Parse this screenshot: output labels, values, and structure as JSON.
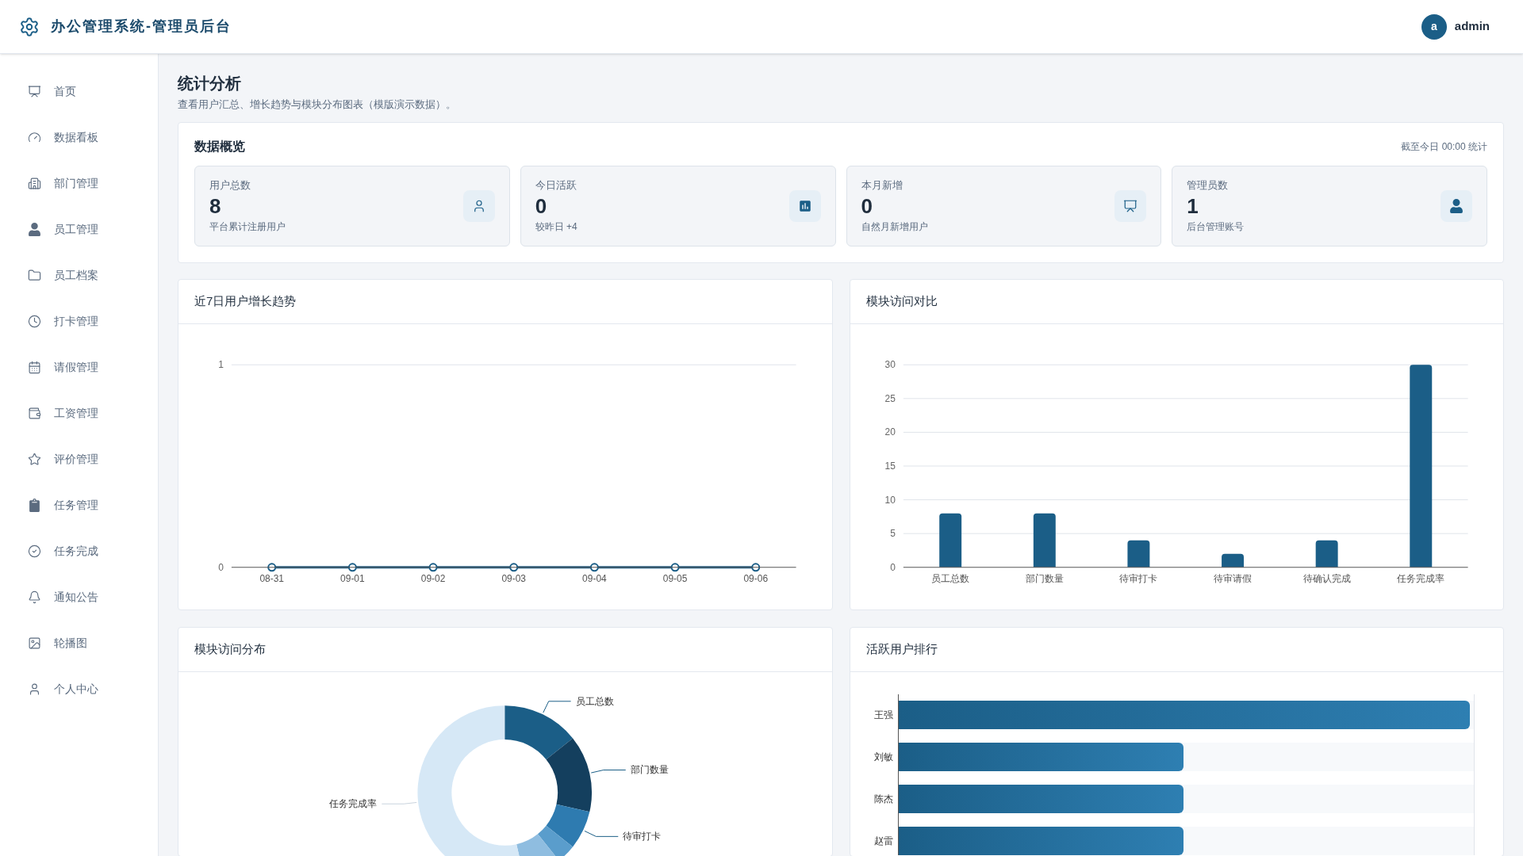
{
  "header": {
    "title": "办公管理系统-管理员后台",
    "user": {
      "avatar": "a",
      "name": "admin"
    }
  },
  "sidebar": {
    "items": [
      {
        "label": "首页"
      },
      {
        "label": "数据看板"
      },
      {
        "label": "部门管理"
      },
      {
        "label": "员工管理"
      },
      {
        "label": "员工档案"
      },
      {
        "label": "打卡管理"
      },
      {
        "label": "请假管理"
      },
      {
        "label": "工资管理"
      },
      {
        "label": "评价管理"
      },
      {
        "label": "任务管理"
      },
      {
        "label": "任务完成"
      },
      {
        "label": "通知公告"
      },
      {
        "label": "轮播图"
      },
      {
        "label": "个人中心"
      }
    ]
  },
  "page": {
    "title": "统计分析",
    "subtitle": "查看用户汇总、增长趋势与模块分布图表（模版演示数据）。"
  },
  "overview": {
    "title": "数据概览",
    "note": "截至今日 00:00 统计",
    "stats": [
      {
        "label": "用户总数",
        "value": "8",
        "hint": "平台累计注册用户"
      },
      {
        "label": "今日活跃",
        "value": "0",
        "hint": "较昨日 +4"
      },
      {
        "label": "本月新增",
        "value": "0",
        "hint": "自然月新增用户"
      },
      {
        "label": "管理员数",
        "value": "1",
        "hint": "后台管理账号"
      }
    ]
  },
  "trend": {
    "title": "近7日用户增长趋势",
    "chart_data": {
      "type": "line",
      "categories": [
        "08-31",
        "09-01",
        "09-02",
        "09-03",
        "09-04",
        "09-05",
        "09-06"
      ],
      "series": [
        {
          "color": "#1b5e87",
          "values": [
            0,
            0,
            0,
            0,
            0,
            0,
            0
          ],
          "marker": true
        }
      ],
      "ylim": [
        0,
        1
      ],
      "yticks": [
        0,
        1
      ],
      "grid": true
    }
  },
  "compare": {
    "title": "模块访问对比",
    "chart_data": {
      "type": "bar",
      "categories": [
        "员工总数",
        "部门数量",
        "待审打卡",
        "待审请假",
        "待确认完成",
        "任务完成率"
      ],
      "series": [
        {
          "color": "#1b5e87",
          "values": [
            8,
            8,
            4,
            2,
            4,
            30
          ]
        }
      ],
      "ylim": [
        0,
        30
      ],
      "yticks": [
        0,
        5,
        10,
        15,
        20,
        25,
        30
      ],
      "grid": true
    }
  },
  "distribution": {
    "title": "模块访问分布",
    "labels": [
      "员工总数",
      "部门数量",
      "待审打卡",
      "任务完成率"
    ]
  },
  "ranking": {
    "title": "活跃用户排行",
    "rows": [
      {
        "name": "王强",
        "level": 1
      },
      {
        "name": "刘敏",
        "level": 0.5
      },
      {
        "name": "陈杰",
        "level": 0.5
      },
      {
        "name": "赵雷",
        "level": 0.5
      }
    ]
  }
}
